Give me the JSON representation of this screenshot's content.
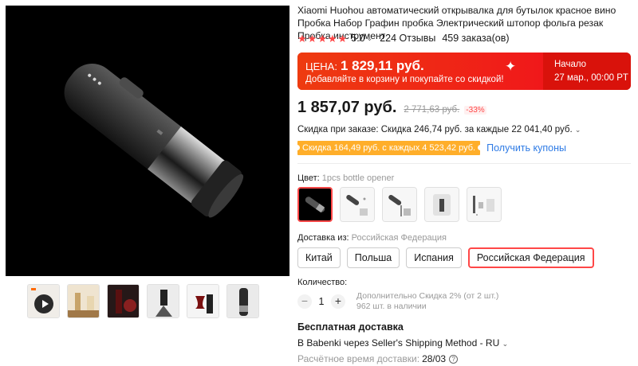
{
  "product": {
    "title": "Xiaomi Huohou автоматический открывалка для бутылок красное вино Пробка Набор Графин пробка Электрический штопор фольга резак Пробка инструмент",
    "rating": "5.0",
    "reviews": "224 Отзывы",
    "orders": "459 заказа(ов)"
  },
  "promo": {
    "label": "ЦЕНА:",
    "price": "1 829,11 руб.",
    "subtitle": "Добавляйте в корзину и покупайте со скидкой!",
    "start_label": "Начало",
    "start_date": "27 мар., 00:00 PT"
  },
  "pricing": {
    "price": "1 857,07 руб.",
    "old_price": "2 771,63 руб.",
    "discount": "-33%",
    "bulk_discount": "Скидка при заказе: Скидка 246,74 руб. за каждые 22 041,40 руб.",
    "coupon_tag": "Скидка 164,49 руб. с каждых 4 523,42 руб.",
    "coupon_link": "Получить купоны"
  },
  "color": {
    "label": "Цвет:",
    "value": "1pcs bottle opener",
    "options": [
      "opener-black",
      "opener-set-1",
      "opener-set-2",
      "opener-box",
      "opener-kit"
    ]
  },
  "shipping_from": {
    "label": "Доставка из:",
    "value": "Российская Федерация",
    "options": [
      "Китай",
      "Польша",
      "Испания",
      "Российская Федерация"
    ],
    "selected_index": 3
  },
  "quantity": {
    "label": "Количество:",
    "value": "1",
    "extra_discount": "Дополнительно Скидка 2% (от 2 шт.)",
    "stock": "962 шт. в наличии"
  },
  "delivery": {
    "title": "Бесплатная доставка",
    "method": "В Babenki через Seller's Shipping Method - RU",
    "time_label": "Расчётное время доставки:",
    "time_value": "28/03"
  },
  "colors": {
    "accent": "#ff4747",
    "promo_red": "#e8200f",
    "coupon_orange": "#ffae2a",
    "link_blue": "#2e7be5"
  }
}
